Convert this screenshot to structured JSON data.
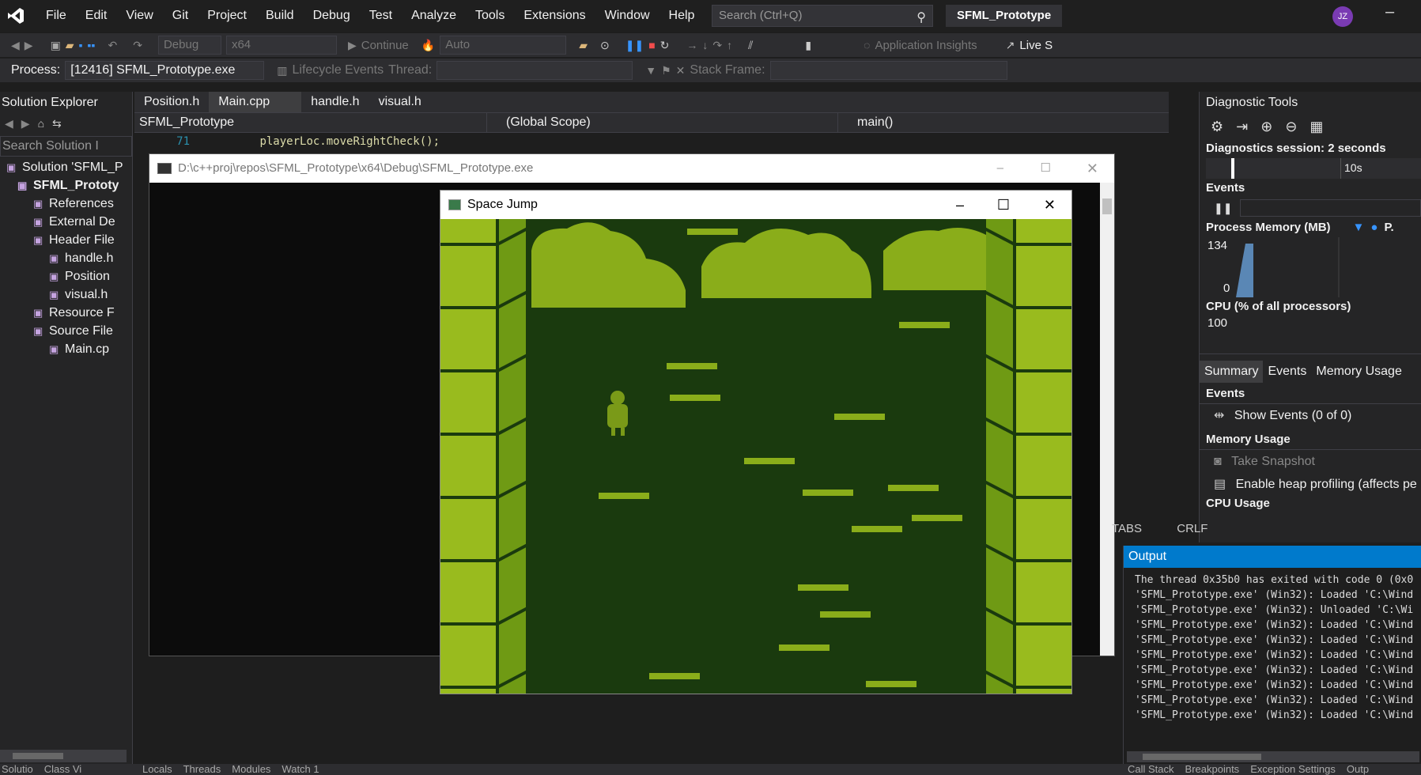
{
  "menu": [
    "File",
    "Edit",
    "View",
    "Git",
    "Project",
    "Build",
    "Debug",
    "Test",
    "Analyze",
    "Tools",
    "Extensions",
    "Window",
    "Help"
  ],
  "search": {
    "placeholder": "Search (Ctrl+Q)"
  },
  "solution_name": "SFML_Prototype",
  "user_initials": "JZ",
  "toolbar1": {
    "config": "Debug",
    "platform": "x64",
    "continue": "Continue",
    "auto": "Auto",
    "insights": "Application Insights",
    "live_share": "Live S"
  },
  "toolbar2": {
    "process_label": "Process:",
    "process_value": "[12416] SFML_Prototype.exe",
    "lifecycle": "Lifecycle Events",
    "thread_label": "Thread:",
    "stack_label": "Stack Frame:"
  },
  "solution_explorer": {
    "title": "Solution Explorer",
    "search_placeholder": "Search Solution I",
    "items": [
      {
        "label": "Solution 'SFML_P",
        "indent": 6
      },
      {
        "label": "SFML_Prototy",
        "indent": 20,
        "bold": true
      },
      {
        "label": "References",
        "indent": 40
      },
      {
        "label": "External De",
        "indent": 40
      },
      {
        "label": "Header File",
        "indent": 40
      },
      {
        "label": "handle.h",
        "indent": 60
      },
      {
        "label": "Position",
        "indent": 60
      },
      {
        "label": "visual.h",
        "indent": 60
      },
      {
        "label": "Resource F",
        "indent": 40
      },
      {
        "label": "Source File",
        "indent": 40
      },
      {
        "label": "Main.cp",
        "indent": 60
      }
    ]
  },
  "editor": {
    "tabs": [
      "Position.h",
      "Main.cpp",
      "handle.h",
      "visual.h"
    ],
    "nav": {
      "project": "SFML_Prototype",
      "scope": "(Global Scope)",
      "func": "main()"
    },
    "line_number": "71",
    "code": "playerLoc.moveRightCheck();"
  },
  "console": {
    "title": "D:\\c++proj\\repos\\SFML_Prototype\\x64\\Debug\\SFML_Prototype.exe"
  },
  "game": {
    "title": "Space Jump"
  },
  "diagnostics": {
    "title": "Diagnostic Tools",
    "session": "Diagnostics session: 2 seconds",
    "timeline_label": "10s",
    "events_label": "Events",
    "process_memory": "Process Memory (MB)",
    "mem_max": "134",
    "mem_min": "0",
    "legend_p": "P.",
    "cpu": "CPU (% of all processors)",
    "cpu_max": "100",
    "tabs": [
      "Summary",
      "Events",
      "Memory Usage"
    ],
    "events_header": "Events",
    "show_events": "Show Events (0 of 0)",
    "memory_header": "Memory Usage",
    "take_snapshot": "Take Snapshot",
    "heap_profiling": "Enable heap profiling (affects pe",
    "cpu_header": "CPU Usage"
  },
  "status": {
    "tabs": "TABS",
    "crlf": "CRLF"
  },
  "output": {
    "title": "Output",
    "lines": [
      "The thread 0x35b0 has exited with code 0 (0x0",
      "'SFML_Prototype.exe' (Win32): Loaded 'C:\\Wind",
      "'SFML_Prototype.exe' (Win32): Unloaded 'C:\\Wi",
      "'SFML_Prototype.exe' (Win32): Loaded 'C:\\Wind",
      "'SFML_Prototype.exe' (Win32): Loaded 'C:\\Wind",
      "'SFML_Prototype.exe' (Win32): Loaded 'C:\\Wind",
      "'SFML_Prototype.exe' (Win32): Loaded 'C:\\Wind",
      "'SFML_Prototype.exe' (Win32): Loaded 'C:\\Wind",
      "'SFML_Prototype.exe' (Win32): Loaded 'C:\\Wind",
      "'SFML_Prototype.exe' (Win32): Loaded 'C:\\Wind"
    ]
  },
  "bottom_tabs": {
    "left": [
      "Solutio",
      "Class Vi"
    ],
    "middle": [
      "Locals",
      "Threads",
      "Modules",
      "Watch 1"
    ],
    "right": [
      "Call Stack",
      "Breakpoints",
      "Exception Settings",
      "Outp"
    ]
  },
  "colors": {
    "accent": "#007acc",
    "game_bg": "#1a3a0e",
    "game_light": "#99bb1e",
    "game_mid": "#6f9a14",
    "platform": "#8aad1a"
  }
}
